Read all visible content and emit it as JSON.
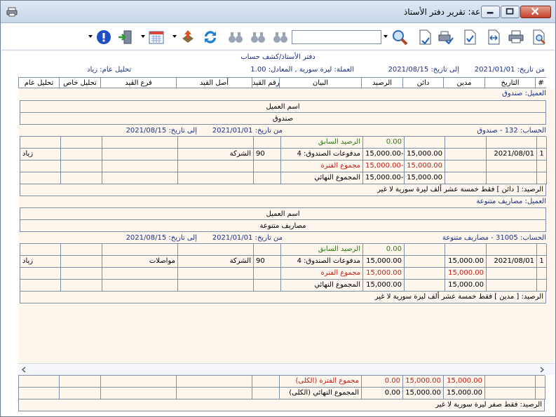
{
  "window": {
    "title": "طباعة: تقرير دفتر الأستاذ",
    "icon": "printer-icon"
  },
  "toolbar": {
    "search_value": "",
    "icons": [
      "preview-icon",
      "print-icon",
      "fit-width-icon",
      "fit-page-icon",
      "print-settings-icon",
      "page-setup-icon",
      "zoom-icon",
      "binoculars-next-icon",
      "binoculars-prev-icon",
      "refresh-icon",
      "export-icon",
      "calendar-icon",
      "exit-icon",
      "help-icon"
    ]
  },
  "report": {
    "title": "دفتر الأستاذ/كشف حساب",
    "from_label": "من تاريخ:",
    "from_date": "2021/01/01",
    "to_label": "إلى تاريخ:",
    "to_date": "2021/08/15",
    "currency_text": "العملة: ليرة سورية , المعادل: 1.00",
    "general_analysis": "تحليل عام: زياد"
  },
  "columns": [
    "#",
    "التاريخ",
    "مدين",
    "دائن",
    "الرصيد",
    "البيان",
    "رقم القيد",
    "أصل القيد",
    "فرع القيد",
    "تحليل خاص",
    "تحليل عام"
  ],
  "sections": [
    {
      "client_label": "العميل: صندوق",
      "client_name_header": "اسم العميل",
      "client_name": "صندوق",
      "account": "الحساب: 132 - صندوق",
      "from_text": "من تاريخ:",
      "from_date": "2021/01/01",
      "to_text": "إلى تاريخ:",
      "to_date": "2021/08/15",
      "prev_label": "الرصيد السابق",
      "prev_value": "0.00",
      "row": {
        "num": "1",
        "date": "2021/08/01",
        "debit": "",
        "credit": "15,000.00",
        "balance": "15,000.00-",
        "desc": "مدفوعات الصندوق: 4",
        "entry": "90",
        "origin": "الشركة",
        "branch": "",
        "special": "",
        "general": "زياد"
      },
      "period_label": "مجموع الفترة",
      "period_debit": "",
      "period_credit": "15,000.00",
      "period_balance": "15,000.00-",
      "final_label": "المجموع النهائي",
      "final_debit": "",
      "final_credit": "15,000.00",
      "final_balance": "15,000.00-",
      "balance_text": "الرصيد: [ دائن ] فقط خمسة عشر ألف ليرة سورية لا غير"
    },
    {
      "client_label": "العميل: مصاريف متنوعة",
      "client_name_header": "اسم العميل",
      "client_name": "مصاريف متنوعة",
      "account": "الحساب: 31005 - مصاريف متنوعة",
      "from_text": "من تاريخ:",
      "from_date": "2021/01/01",
      "to_text": "إلى تاريخ:",
      "to_date": "2021/08/15",
      "prev_label": "الرصيد السابق",
      "prev_value": "0.00",
      "row": {
        "num": "1",
        "date": "2021/08/01",
        "debit": "15,000.00",
        "credit": "",
        "balance": "15,000.00",
        "desc": "مدفوعات الصندوق: 4",
        "entry": "90",
        "origin": "الشركة",
        "branch": "مواصلات",
        "special": "",
        "general": "زياد"
      },
      "period_label": "مجموع الفترة",
      "period_debit": "15,000.00",
      "period_credit": "",
      "period_balance": "15,000.00",
      "final_label": "المجموع النهائي",
      "final_debit": "15,000.00",
      "final_credit": "",
      "final_balance": "15,000.00",
      "balance_text": "الرصيد: [ مدين ] فقط خمسة عشر ألف ليرة سورية لا غير"
    }
  ],
  "summary": {
    "period_label": "مجموع الفترة (الكلى)",
    "period_debit": "15,000.00",
    "period_credit": "15,000.00",
    "period_balance": "0.00",
    "final_label": "المجموع النهائي (الكلى)",
    "final_debit": "15,000.00",
    "final_credit": "15,000.00",
    "final_balance": "0.00",
    "balance_text": "الرصيد: فقط صفر ليرة سورية لا غير"
  },
  "colors": {
    "blue_text": "#1b2f8a",
    "green_text": "#2b7a12",
    "red_text": "#c0201a",
    "body_bg": "#fdf6ec"
  }
}
